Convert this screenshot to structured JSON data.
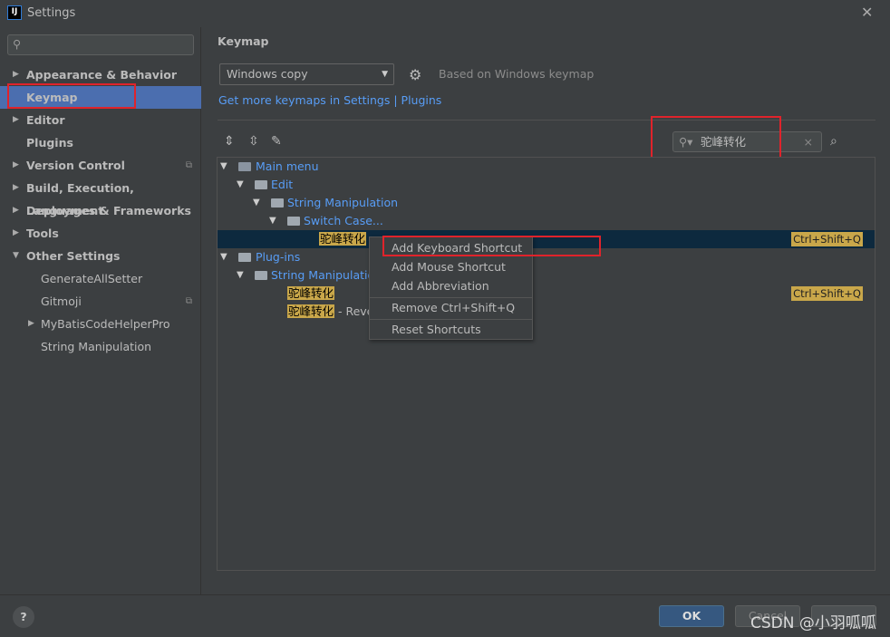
{
  "window": {
    "title": "Settings",
    "app_icon": "IJ",
    "close": "✕"
  },
  "sidebar": {
    "search_placeholder": "",
    "items": [
      {
        "label": "Appearance & Behavior",
        "expandable": true
      },
      {
        "label": "Keymap",
        "selected": true
      },
      {
        "label": "Editor",
        "expandable": true
      },
      {
        "label": "Plugins"
      },
      {
        "label": "Version Control",
        "expandable": true
      },
      {
        "label": "Build, Execution, Deployment",
        "expandable": true
      },
      {
        "label": "Languages & Frameworks",
        "expandable": true
      },
      {
        "label": "Tools",
        "expandable": true
      },
      {
        "label": "Other Settings",
        "expanded": true
      },
      {
        "label": "GenerateAllSetter"
      },
      {
        "label": "Gitmoji"
      },
      {
        "label": "MyBatisCodeHelperPro",
        "expandable": true
      },
      {
        "label": "String Manipulation"
      }
    ]
  },
  "keymap": {
    "title": "Keymap",
    "selected": "Windows copy",
    "based_on": "Based on Windows keymap",
    "links": "Get more keymaps in Settings | Plugins",
    "search_value": "驼峰转化"
  },
  "tree": {
    "main_menu": "Main menu",
    "edit": "Edit",
    "string_manip": "String Manipulation",
    "switch_case": "Switch Case...",
    "action": "驼峰转化",
    "shortcut": "Ctrl+Shift+Q",
    "plugins": "Plug-ins",
    "plugin_sm": "String Manipulation",
    "plugin_action": "驼峰转化",
    "plugin_action2": "驼峰转化",
    "plugin_action2_suffix": " - Reve",
    "plugin_shortcut": "Ctrl+Shift+Q"
  },
  "context_menu": [
    "Add Keyboard Shortcut",
    "Add Mouse Shortcut",
    "Add Abbreviation",
    "Remove Ctrl+Shift+Q",
    "Reset Shortcuts"
  ],
  "footer": {
    "help": "?",
    "ok": "OK",
    "cancel": "Cancel",
    "apply": ""
  },
  "watermark": "CSDN @小羽呱呱",
  "colors": {
    "accent": "#4b6eaf",
    "link": "#589df6",
    "highlight": "#c9a74a",
    "annotation": "#e0232b"
  }
}
